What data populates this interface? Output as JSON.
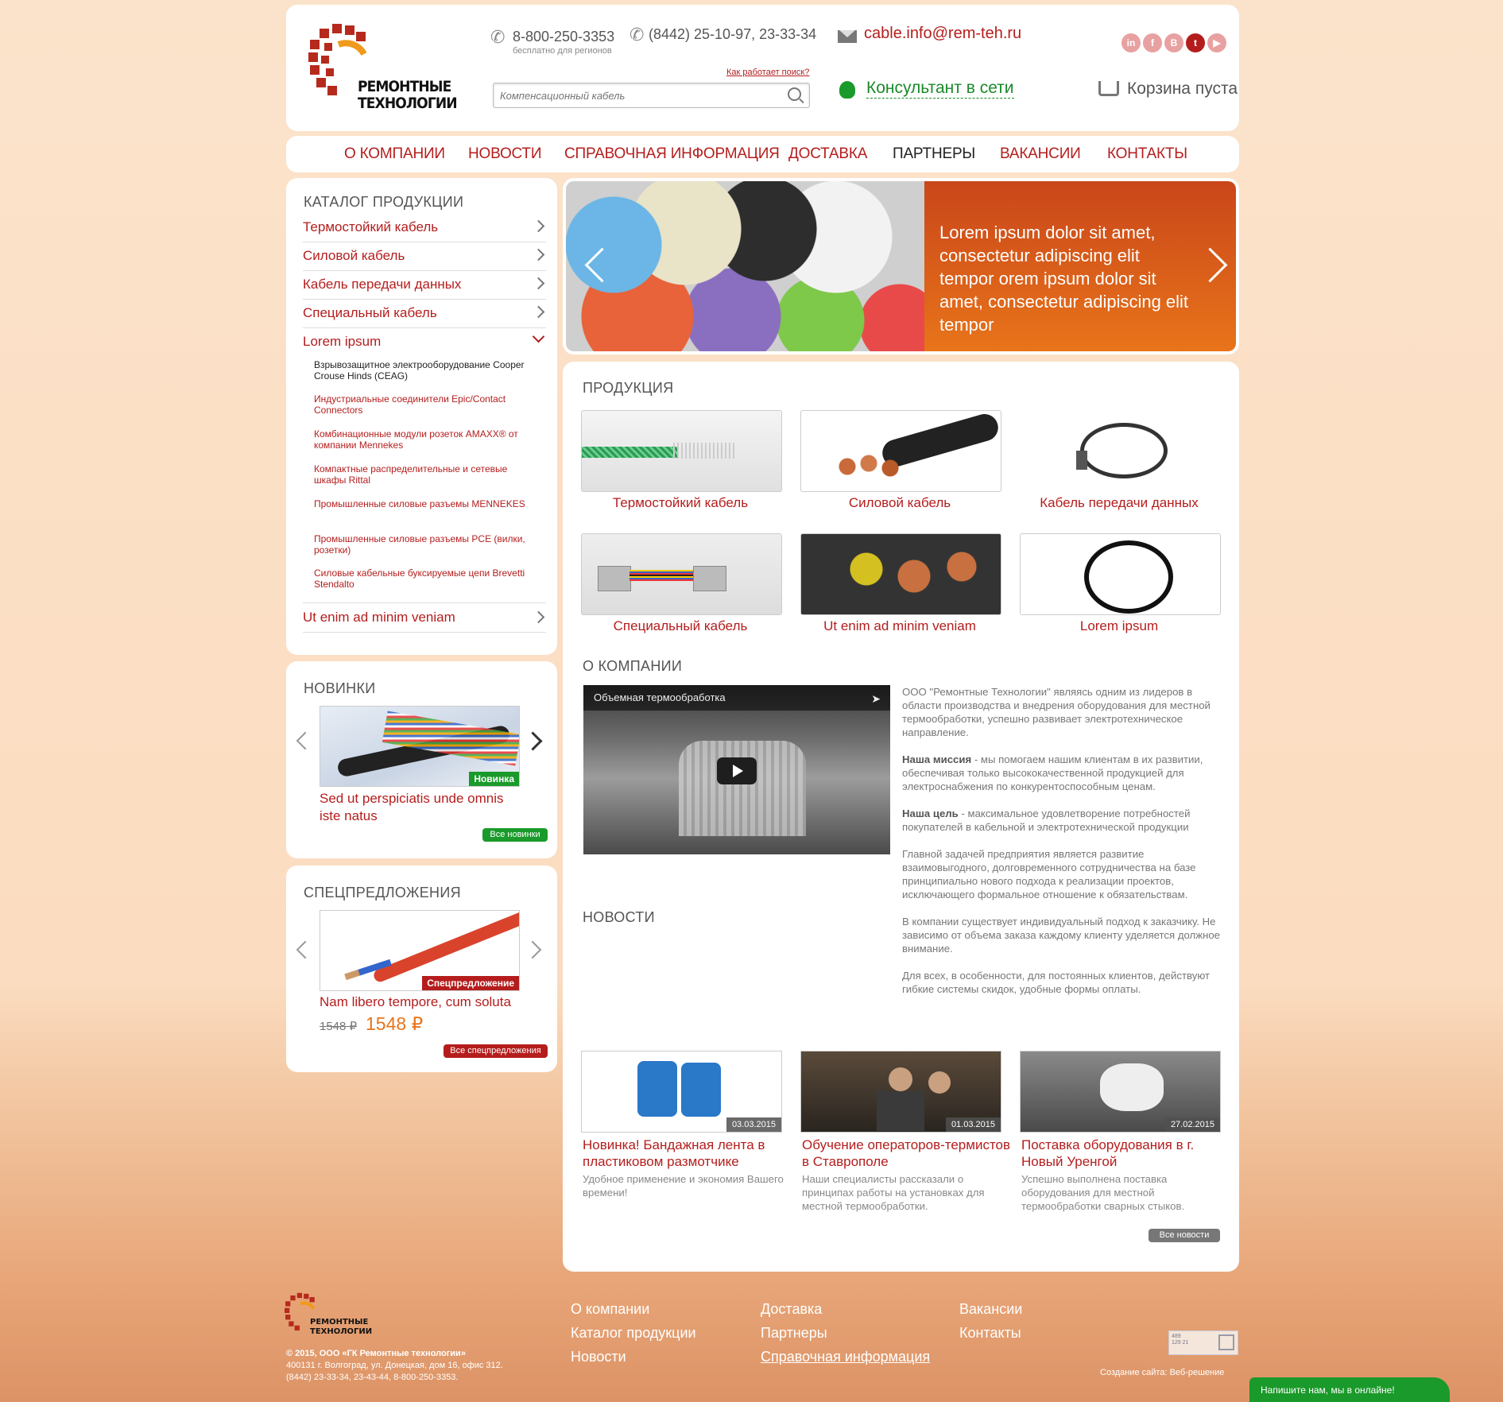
{
  "header": {
    "logo_line1": "РЕМОНТНЫЕ",
    "logo_line2": "ТЕХНОЛОГИИ",
    "phone1": "8-800-250-3353",
    "phone1_note": "бесплатно для регионов",
    "phone2": "(8442) 25-10-97, 23-33-34",
    "email": "cable.info@rem-teh.ru",
    "search_help": "Как работает поиск?",
    "search_placeholder": "Компенсационный кабель",
    "consultant": "Консультант в сети",
    "cart": "Корзина пуста",
    "social": [
      "in",
      "f",
      "B",
      "t",
      "yt"
    ]
  },
  "nav": {
    "items": [
      "О КОМПАНИИ",
      "НОВОСТИ",
      "СПРАВОЧНАЯ ИНФОРМАЦИЯ",
      "ДОСТАВКА",
      "ПАРТНЕРЫ",
      "ВАКАНСИИ",
      "КОНТАКТЫ"
    ],
    "active_index": 4
  },
  "catalog": {
    "title": "КАТАЛОГ ПРОДУКЦИИ",
    "items": [
      "Термостойкий кабель",
      "Силовой кабель",
      "Кабель передачи данных",
      "Специальный кабель",
      "Lorem ipsum"
    ],
    "subitems": [
      "Взрывозащитное электрооборудование Cooper Crouse Hinds (CEAG)",
      "Индустриальные соединители Epic/Contact Connectors",
      "Комбинационные модули розеток AMAXX® от компании Mennekes",
      "Компактные распределительные и сетевые шкафы Rittal",
      "Промышленные силовые разъемы MENNEKES",
      "Промышленные силовые разъемы PCE (вилки, розетки)",
      "Силовые кабельные буксируемые цепи Brevetti Stendalto"
    ],
    "last_item": "Ut enim ad minim veniam"
  },
  "novelties": {
    "title": "НОВИНКИ",
    "badge": "Новинка",
    "item_title": "Sed ut perspiciatis unde omnis iste natus",
    "all_button": "Все новинки"
  },
  "specials": {
    "title": "СПЕЦПРЕДЛОЖЕНИЯ",
    "badge": "Спецпредложение",
    "item_title": "Nam libero tempore, cum soluta",
    "old_price": "1548",
    "price": "1548",
    "currency": "₽",
    "all_button": "Все спецпредложения"
  },
  "banner": {
    "text": "Lorem ipsum dolor sit amet, consectetur adipiscing elit tempor orem ipsum dolor sit amet, consectetur adipiscing elit tempor"
  },
  "products": {
    "title": "ПРОДУКЦИЯ",
    "items": [
      "Термостойкий кабель",
      "Силовой кабель",
      "Кабель передачи данных",
      "Специальный кабель",
      "Ut enim ad minim veniam",
      "Lorem ipsum"
    ]
  },
  "about": {
    "title": "О КОМПАНИИ",
    "video_title": "Объемная термообработка",
    "p1": "ООО \"Ремонтные Технологии\" являясь одним из лидеров в области производства и внедрения оборудования для местной термообработки, успешно развивает электротехническое направление.",
    "mission_label": "Наша миссия",
    "mission_text": " - мы помогаем нашим клиентам в их развитии, обеспечивая только высококачественной продукцией для электроснабжения по конкурентоспособным ценам.",
    "goal_label": "Наша цель",
    "goal_text": " - максимальное удовлетворение потребностей покупателей в кабельной и электротехнической продукции",
    "p4": "Главной задачей предприятия является развитие взаимовыгодного, долговременного сотрудничества на базе принципиально нового подхода к реализации проектов, исключающего формальное отношение к обязательствам.",
    "p5": "В компании существует индивидуальный подход к заказчику. Не зависимо от объема заказа каждому клиенту уделяется должное внимание.",
    "p6": "Для всех, в особенности, для постоянных клиентов, действуют гибкие системы скидок, удобные формы оплаты."
  },
  "news": {
    "title": "НОВОСТИ",
    "items": [
      {
        "date": "03.03.2015",
        "title": "Новинка! Бандажная лента в пластиковом размотчике",
        "desc": "Удобное применение и экономия Вашего времени!"
      },
      {
        "date": "01.03.2015",
        "title": "Обучение операторов-термистов в Ставрополе",
        "desc": "Наши специалисты рассказали о принципах работы на установках для местной термообработки."
      },
      {
        "date": "27.02.2015",
        "title": "Поставка оборудования в г. Новый Уренгой",
        "desc": "Успешно выполнена поставка оборудования для местной термообработки сварных стыков."
      }
    ],
    "all_button": "Все новости"
  },
  "footer": {
    "copyright": "© 2015, ООО «ГК Ремонтные технологии»",
    "address": "400131 г. Волгоград, ул. Донецкая, дом 16, офис 312.",
    "phones": "(8442) 23-33-34,  23-43-44,  8-800-250-3353.",
    "col1": [
      "О компании",
      "Каталог продукции",
      "Новости"
    ],
    "col2": [
      "Доставка",
      "Партнеры",
      "Справочная информация"
    ],
    "col3": [
      "Вакансии",
      "Контакты"
    ],
    "counter": "489 129 21",
    "credit": "Создание сайта: Веб-решение",
    "chat": "Напишите нам, мы в онлайне!"
  },
  "colors": {
    "brand_red": "#b51d1d",
    "accent_orange": "#e8741a",
    "green": "#1a9a2a"
  }
}
